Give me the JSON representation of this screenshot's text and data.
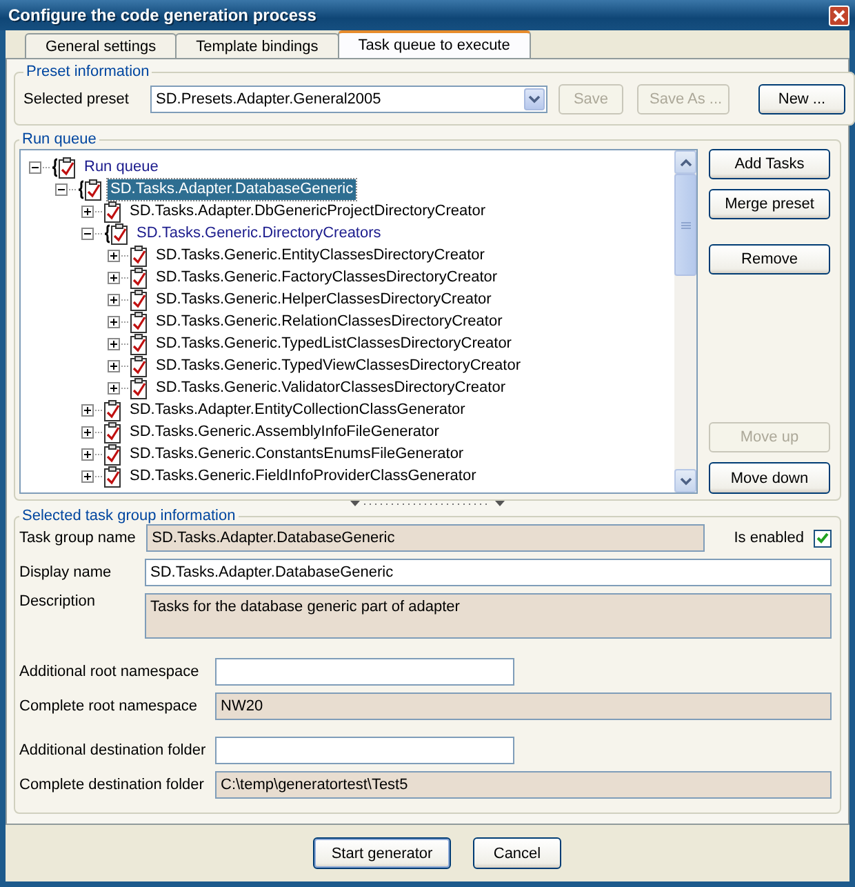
{
  "window": {
    "title": "Configure the code generation process"
  },
  "tabs": [
    {
      "label": "General settings",
      "selected": false
    },
    {
      "label": "Template bindings",
      "selected": false
    },
    {
      "label": "Task queue to execute",
      "selected": true
    }
  ],
  "preset": {
    "title": "Preset information",
    "label": "Selected preset",
    "value": "SD.Presets.Adapter.General2005",
    "buttons": [
      {
        "label": "Save",
        "disabled": true
      },
      {
        "label": "Save As ...",
        "disabled": true
      },
      {
        "label": "New ...",
        "disabled": false
      }
    ]
  },
  "run_queue": {
    "title": "Run queue",
    "tree": [
      {
        "label": "Run queue",
        "kind": "group",
        "expanded": true,
        "selected": false,
        "children": [
          {
            "label": "SD.Tasks.Adapter.DatabaseGeneric",
            "kind": "group",
            "expanded": true,
            "selected": true,
            "children": [
              {
                "label": "SD.Tasks.Adapter.DbGenericProjectDirectoryCreator",
                "kind": "task",
                "expanded": false,
                "selected": false
              },
              {
                "label": "SD.Tasks.Generic.DirectoryCreators",
                "kind": "group",
                "expanded": true,
                "selected": false,
                "children": [
                  {
                    "label": "SD.Tasks.Generic.EntityClassesDirectoryCreator",
                    "kind": "task",
                    "expanded": false,
                    "selected": false
                  },
                  {
                    "label": "SD.Tasks.Generic.FactoryClassesDirectoryCreator",
                    "kind": "task",
                    "expanded": false,
                    "selected": false
                  },
                  {
                    "label": "SD.Tasks.Generic.HelperClassesDirectoryCreator",
                    "kind": "task",
                    "expanded": false,
                    "selected": false
                  },
                  {
                    "label": "SD.Tasks.Generic.RelationClassesDirectoryCreator",
                    "kind": "task",
                    "expanded": false,
                    "selected": false
                  },
                  {
                    "label": "SD.Tasks.Generic.TypedListClassesDirectoryCreator",
                    "kind": "task",
                    "expanded": false,
                    "selected": false
                  },
                  {
                    "label": "SD.Tasks.Generic.TypedViewClassesDirectoryCreator",
                    "kind": "task",
                    "expanded": false,
                    "selected": false
                  },
                  {
                    "label": "SD.Tasks.Generic.ValidatorClassesDirectoryCreator",
                    "kind": "task",
                    "expanded": false,
                    "selected": false
                  }
                ]
              },
              {
                "label": "SD.Tasks.Adapter.EntityCollectionClassGenerator",
                "kind": "task",
                "expanded": false,
                "selected": false
              },
              {
                "label": "SD.Tasks.Generic.AssemblyInfoFileGenerator",
                "kind": "task",
                "expanded": false,
                "selected": false
              },
              {
                "label": "SD.Tasks.Generic.ConstantsEnumsFileGenerator",
                "kind": "task",
                "expanded": false,
                "selected": false
              },
              {
                "label": "SD.Tasks.Generic.FieldInfoProviderClassGenerator",
                "kind": "task",
                "expanded": false,
                "selected": false
              }
            ]
          }
        ]
      }
    ],
    "buttons": [
      {
        "label": "Add Tasks",
        "disabled": false
      },
      {
        "label": "Merge preset",
        "disabled": false
      },
      {
        "label": "Remove",
        "disabled": false
      },
      {
        "label": "Move up",
        "disabled": true
      },
      {
        "label": "Move down",
        "disabled": false
      }
    ]
  },
  "task_group": {
    "title": "Selected task group information",
    "enabled": {
      "label": "Is enabled",
      "checked": true
    },
    "fields": [
      {
        "label": "Task group name",
        "value": "SD.Tasks.Adapter.DatabaseGeneric",
        "kind": "readonly"
      },
      {
        "label": "Display name",
        "value": "SD.Tasks.Adapter.DatabaseGeneric",
        "kind": "text"
      },
      {
        "label": "Description",
        "value": "Tasks for the database generic part of adapter",
        "kind": "multiline"
      }
    ],
    "namespace_fields": [
      {
        "label": "Additional root namespace",
        "kind": "text"
      },
      {
        "label": "Complete root namespace",
        "value": "NW20",
        "kind": "readonly"
      },
      {
        "label": "Additional destination folder",
        "kind": "text"
      },
      {
        "label": "Complete destination folder",
        "value": "C:\\temp\\generatortest\\Test5",
        "kind": "readonly"
      }
    ]
  },
  "footer": {
    "buttons": [
      {
        "label": "Start generator",
        "default": true
      },
      {
        "label": "Cancel",
        "default": false
      }
    ]
  }
}
